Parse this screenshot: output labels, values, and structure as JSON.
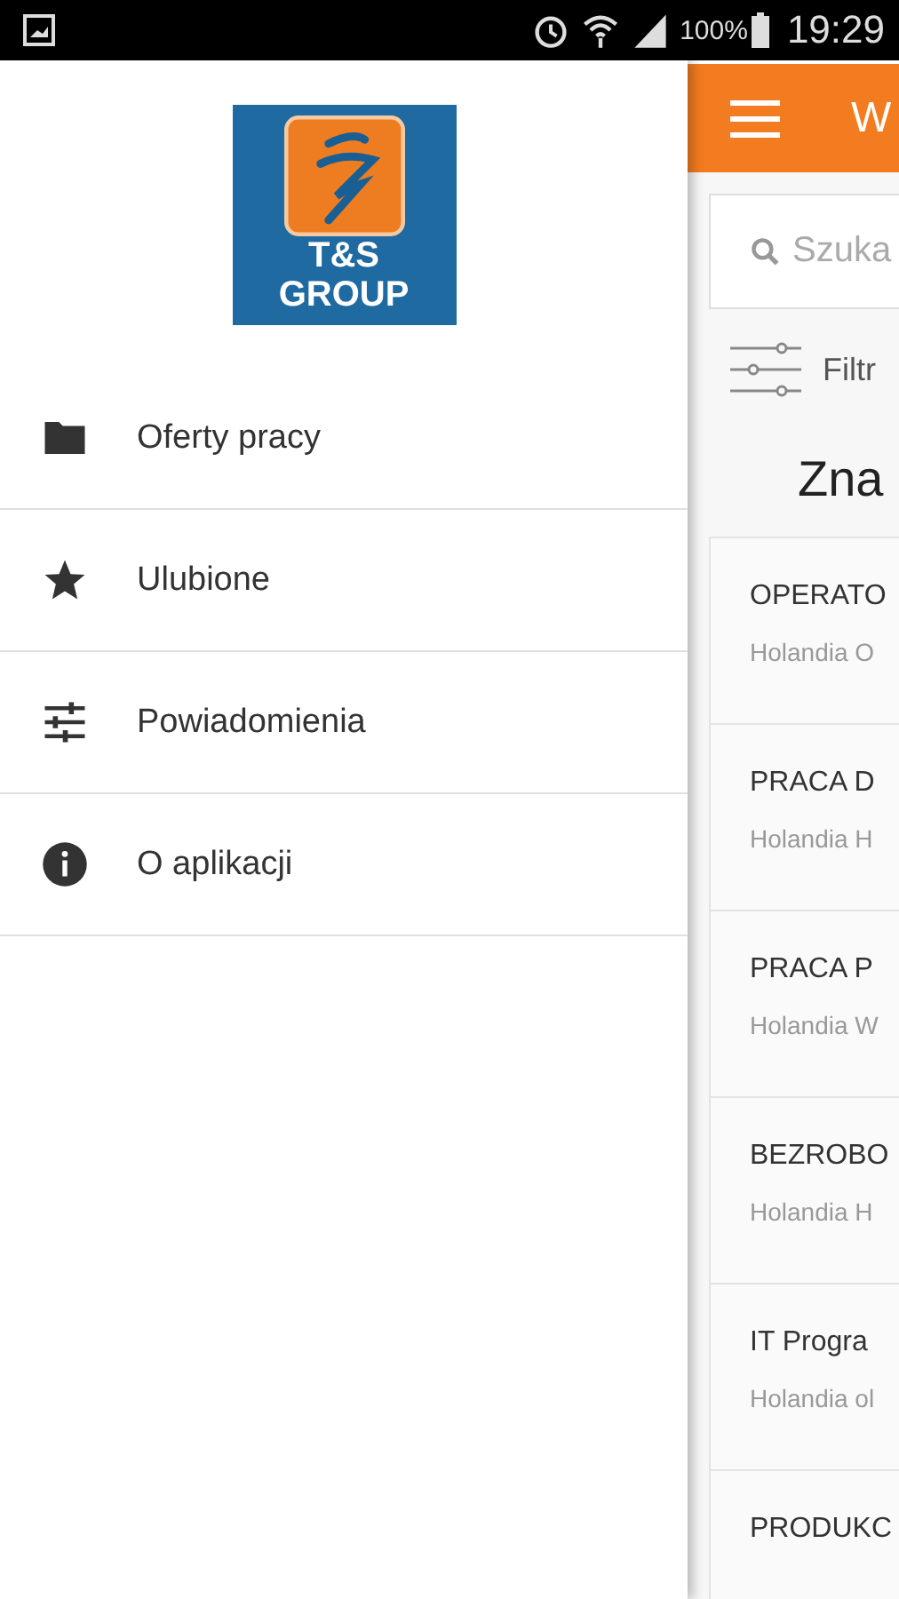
{
  "status_bar": {
    "battery": "100%",
    "time": "19:29"
  },
  "drawer": {
    "logo": {
      "line_1": "T&S",
      "line_2": "GROUP"
    },
    "items": [
      {
        "label": "Oferty pracy"
      },
      {
        "label": "Ulubione"
      },
      {
        "label": "Powiadomienia"
      },
      {
        "label": "O aplikacji"
      }
    ]
  },
  "main": {
    "header_title": "W",
    "search": {
      "placeholder": "Szuka"
    },
    "filter": "Filtr",
    "heading": "Zna",
    "jobs": [
      {
        "title": "OPERATO",
        "location": "Holandia O"
      },
      {
        "title": "PRACA D",
        "location": "Holandia H"
      },
      {
        "title": "PRACA P",
        "location": "Holandia W"
      },
      {
        "title": "BEZROBO",
        "location": "Holandia H"
      },
      {
        "title": "IT Progra",
        "location": "Holandia ol"
      },
      {
        "title": "PRODUKC"
      }
    ]
  }
}
